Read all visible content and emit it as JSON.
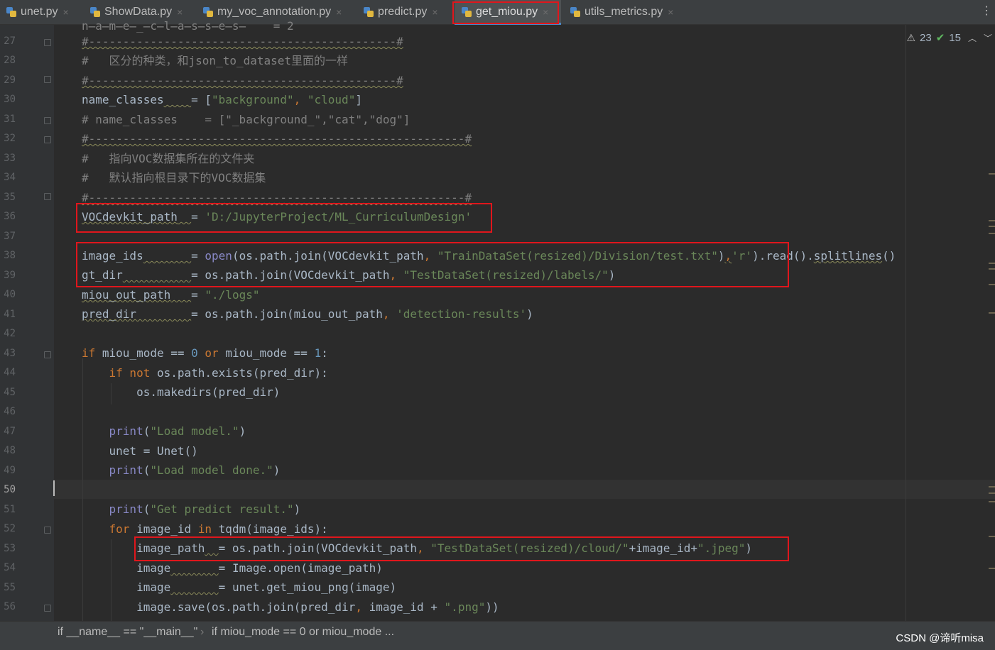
{
  "tabs": [
    {
      "label": "unet.py",
      "close": "×"
    },
    {
      "label": "ShowData.py",
      "close": "×"
    },
    {
      "label": "my_voc_annotation.py",
      "close": "×"
    },
    {
      "label": "predict.py",
      "close": "×"
    },
    {
      "label": "get_miou.py",
      "close": "×",
      "active": true
    },
    {
      "label": "utils_metrics.py",
      "close": "×"
    }
  ],
  "inspection": {
    "warnings": "23",
    "weak_warnings": "15"
  },
  "line_numbers": [
    "27",
    "28",
    "29",
    "30",
    "31",
    "32",
    "33",
    "34",
    "35",
    "36",
    "37",
    "38",
    "39",
    "40",
    "41",
    "42",
    "43",
    "44",
    "45",
    "46",
    "47",
    "48",
    "49",
    "50",
    "51",
    "52",
    "53",
    "54",
    "55",
    "56"
  ],
  "current_line": "50",
  "breadcrumb": {
    "item1": "if __name__ == \"__main__\"",
    "separator": "›",
    "item2": "if miou_mode == 0 or miou_mode ..."
  },
  "watermark": "CSDN @谛听misa",
  "colors": {
    "accent": "#4a88c7",
    "highlight_box": "#e0161c",
    "string": "#6a8759",
    "keyword": "#cc7832",
    "comment": "#808080"
  }
}
